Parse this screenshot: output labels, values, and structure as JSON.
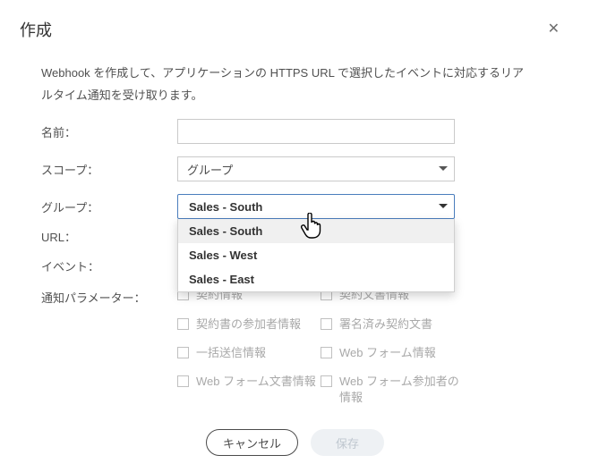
{
  "header": {
    "title": "作成"
  },
  "description": "Webhook を作成して、アプリケーションの HTTPS URL で選択したイベントに対応するリアルタイム通知を受け取ります。",
  "fields": {
    "name": {
      "label": "名前：",
      "value": ""
    },
    "scope": {
      "label": "スコープ：",
      "selected": "グループ"
    },
    "group": {
      "label": "グループ：",
      "selected": "Sales - South",
      "options": [
        "Sales - South",
        "Sales - West",
        "Sales - East"
      ]
    },
    "url": {
      "label": "URL：",
      "value": ""
    },
    "events": {
      "label": "イベント：",
      "value": ""
    }
  },
  "params": {
    "label": "通知パラメーター：",
    "items": [
      "契約情報",
      "契約文書情報",
      "契約書の参加者情報",
      "署名済み契約文書",
      "一括送信情報",
      "Web フォーム情報",
      "Web フォーム文書情報",
      "Web フォーム参加者の情報"
    ]
  },
  "buttons": {
    "cancel": "キャンセル",
    "save": "保存"
  }
}
